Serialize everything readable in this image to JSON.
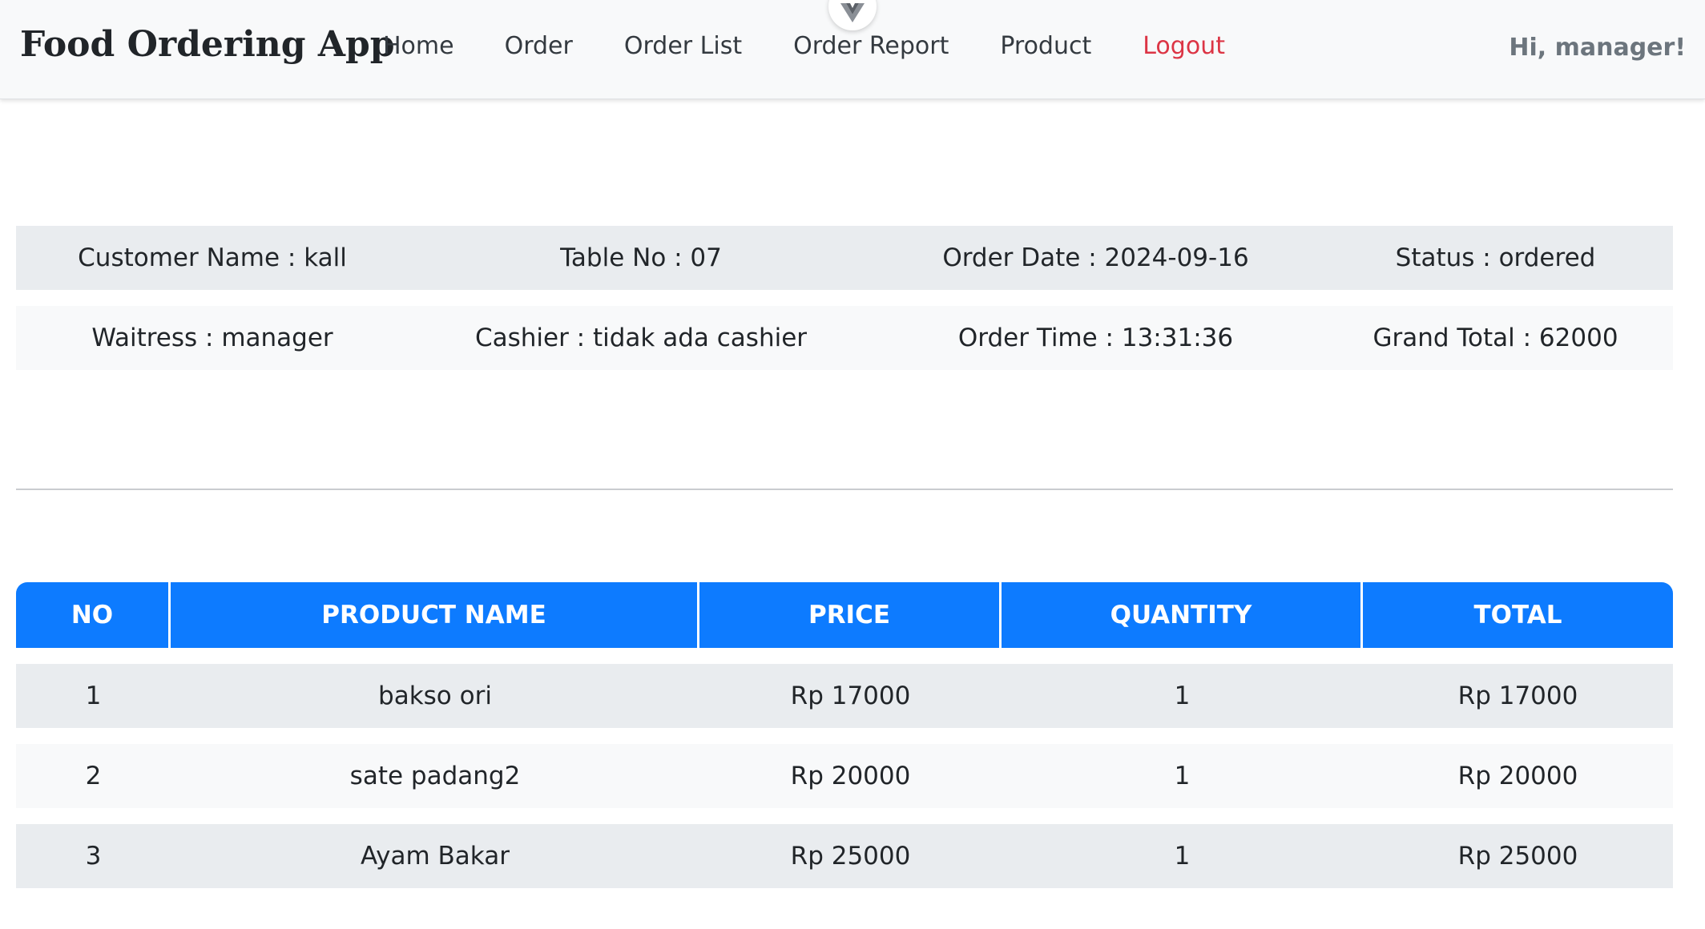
{
  "app": {
    "brand": "Food Ordering App",
    "greeting": "Hi, manager!"
  },
  "nav": {
    "items": [
      {
        "label": "Home"
      },
      {
        "label": "Order"
      },
      {
        "label": "Order List"
      },
      {
        "label": "Order Report"
      },
      {
        "label": "Product"
      },
      {
        "label": "Logout"
      }
    ]
  },
  "order": {
    "customer": "Customer Name : kall",
    "table": "Table No : 07",
    "date": "Order Date : 2024-09-16",
    "status": "Status : ordered",
    "waitress": "Waitress : manager",
    "cashier": "Cashier : tidak ada cashier",
    "time": "Order Time : 13:31:36",
    "grand_total": "Grand Total : 62000"
  },
  "table": {
    "headers": [
      "NO",
      "PRODUCT NAME",
      "PRICE",
      "QUANTITY",
      "TOTAL"
    ],
    "rows": [
      {
        "no": "1",
        "name": "bakso ori",
        "price": "Rp 17000",
        "qty": "1",
        "total": "Rp 17000"
      },
      {
        "no": "2",
        "name": "sate padang2",
        "price": "Rp 20000",
        "qty": "1",
        "total": "Rp 20000"
      },
      {
        "no": "3",
        "name": "Ayam Bakar",
        "price": "Rp 25000",
        "qty": "1",
        "total": "Rp 25000"
      }
    ]
  },
  "colors": {
    "header_blue": "#0d7bff",
    "logout_red": "#dc3545",
    "row_odd": "#e9ecef",
    "row_even": "#f8f9fa"
  },
  "icons": {
    "devtools": "vue-logo-icon"
  }
}
